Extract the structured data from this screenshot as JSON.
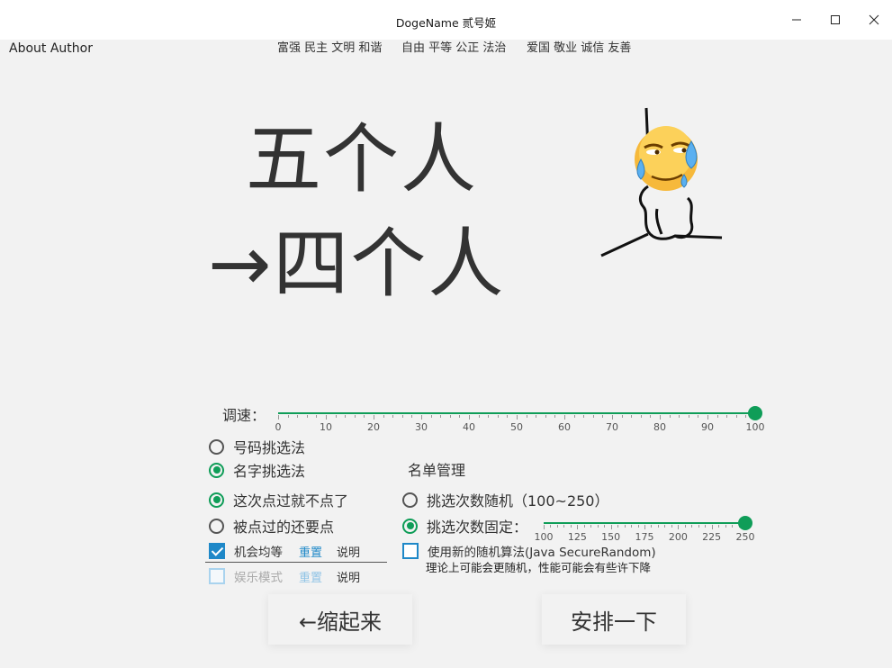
{
  "window": {
    "title": "DogeName 贰号姬",
    "minimize_icon": "minimize-icon",
    "maximize_icon": "maximize-icon",
    "close_icon": "close-icon"
  },
  "menu": {
    "about": "About Author"
  },
  "motto": [
    "富强 民主 文明 和谐",
    "自由 平等 公正 法治",
    "爱国 敬业 诚信 友善"
  ],
  "display": {
    "line1": "五个人",
    "line2": "→四个人"
  },
  "speed": {
    "label": "调速：",
    "value": 100,
    "min": 0,
    "max": 100,
    "ticks": [
      "0",
      "10",
      "20",
      "30",
      "40",
      "50",
      "60",
      "70",
      "80",
      "90",
      "100"
    ]
  },
  "mode": {
    "number_pick": "号码挑选法",
    "name_pick": "名字挑选法",
    "selected": "name_pick"
  },
  "repeat": {
    "no_repeat": "这次点过就不点了",
    "allow_repeat": "被点过的还要点",
    "selected": "no_repeat"
  },
  "fairness": {
    "label": "机会均等",
    "checked": true,
    "reset": "重置",
    "explain": "说明"
  },
  "fun_mode": {
    "label": "娱乐模式",
    "checked": false,
    "reset": "重置",
    "explain": "说明"
  },
  "list_management": "名单管理",
  "pick_count": {
    "random": "挑选次数随机（100~250）",
    "fixed": "挑选次数固定：",
    "selected": "fixed",
    "value": 250,
    "min": 100,
    "max": 250,
    "ticks": [
      "100",
      "125",
      "150",
      "175",
      "200",
      "225",
      "250"
    ]
  },
  "secure_random": {
    "label": "使用新的随机算法(Java SecureRandom)",
    "note": "理论上可能会更随机，性能可能会有些许下降",
    "checked": false
  },
  "buttons": {
    "collapse": "←缩起来",
    "arrange": "安排一下"
  },
  "colors": {
    "accent": "#0f9d58",
    "checkbox": "#1e88c8",
    "background": "#f2f2f2"
  },
  "figure_icon": "crying-emoji-stick-figure-icon"
}
